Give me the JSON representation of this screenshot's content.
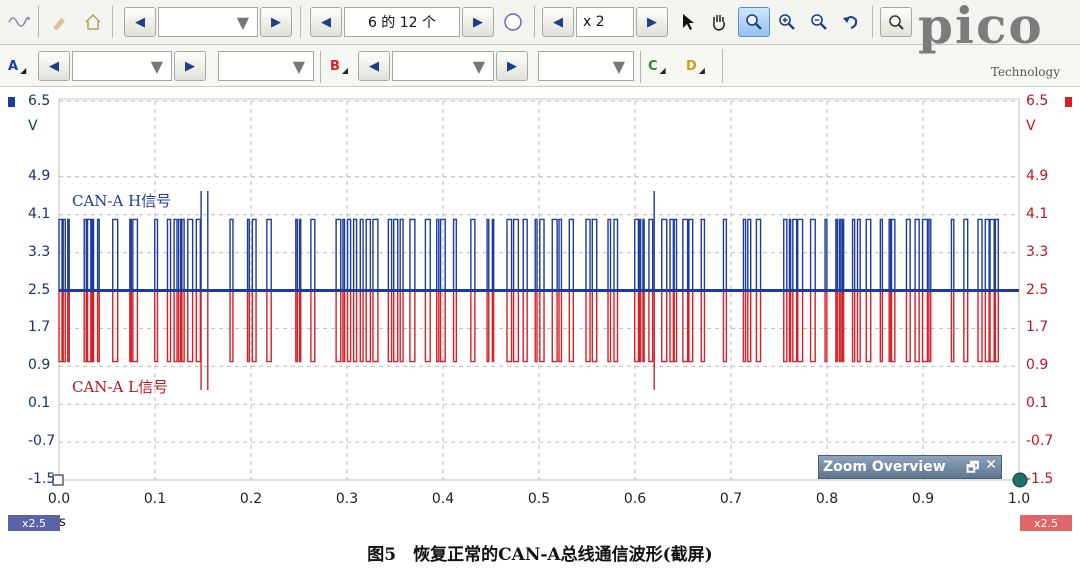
{
  "toolbar": {
    "capture_counter": "6 的 12 个",
    "zoom_factor": "x 2",
    "timebase_value": "",
    "samples_value": ""
  },
  "channels": {
    "a": "A",
    "b": "B",
    "c": "C",
    "d": "D"
  },
  "logo": {
    "word": "pico",
    "sub": "Technology"
  },
  "axes": {
    "left_unit": "V",
    "right_unit": "V",
    "y_ticks": [
      "6.5",
      "4.9",
      "4.1",
      "3.3",
      "2.5",
      "1.7",
      "0.9",
      "0.1",
      "-0.7",
      "-1.5"
    ],
    "x_ticks": [
      "0.0",
      "0.1",
      "0.2",
      "0.3",
      "0.4",
      "0.5",
      "0.6",
      "0.7",
      "0.8",
      "0.9",
      "1.0"
    ],
    "x_unit": "s"
  },
  "signals": {
    "h_label": "CAN-A H信号",
    "l_label": "CAN-A L信号"
  },
  "zoom_overview": {
    "title": "Zoom Overview",
    "restore": "🗗",
    "close": "✕"
  },
  "badges": {
    "left": "x2.5",
    "right": "x2.5"
  },
  "caption": "图5　恢复正常的CAN-A总线通信波形(截屏)",
  "colors": {
    "channel_a": "#1b3b9e",
    "channel_b": "#d81f26",
    "grid": "#b9b9b9"
  },
  "chart_data": {
    "type": "line",
    "title": "",
    "xlabel": "s",
    "ylabel": "V",
    "xlim": [
      0.0,
      1.0
    ],
    "ylim": [
      -1.5,
      6.5
    ],
    "grid": true,
    "series": [
      {
        "name": "CAN-A H信号",
        "baseline": 2.5,
        "dominant": 4.0,
        "peak": 4.6,
        "color": "#1b3b9e"
      },
      {
        "name": "CAN-A L信号",
        "baseline": 2.5,
        "dominant": 1.0,
        "trough": 0.4,
        "color": "#d81f26"
      }
    ]
  }
}
